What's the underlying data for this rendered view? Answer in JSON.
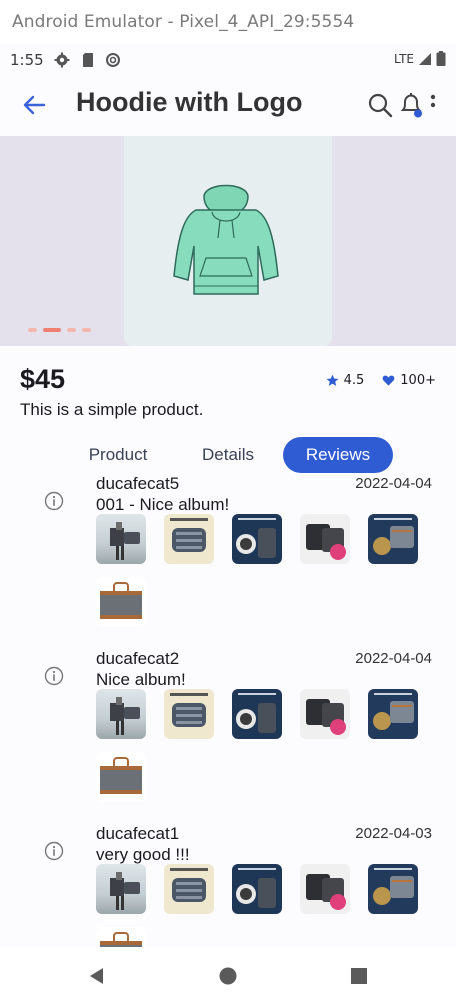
{
  "emulator": {
    "title": "Android Emulator - Pixel_4_API_29:5554"
  },
  "status_bar": {
    "time": "1:55",
    "network": "LTE"
  },
  "app_bar": {
    "title": "Hoodie with Logo"
  },
  "carousel": {
    "page_count": 4,
    "active_index": 1
  },
  "product": {
    "price": "$45",
    "description": "This is a simple product.",
    "rating": "4.5",
    "likes": "100+"
  },
  "tabs": [
    {
      "label": "Product",
      "selected": false
    },
    {
      "label": "Details",
      "selected": false
    },
    {
      "label": "Reviews",
      "selected": true
    }
  ],
  "reviews": [
    {
      "user": "ducafecat5",
      "date": "2022-04-04",
      "text": "001 - Nice album!"
    },
    {
      "user": "ducafecat2",
      "date": "2022-04-04",
      "text": "Nice album!"
    },
    {
      "user": "ducafecat1",
      "date": "2022-04-03",
      "text": "very good !!!"
    }
  ],
  "colors": {
    "accent": "#2f5bd3",
    "carousel_bg": "#e4e0ec",
    "indicator": "#f08070",
    "hoodie": "#7fd6b5"
  }
}
